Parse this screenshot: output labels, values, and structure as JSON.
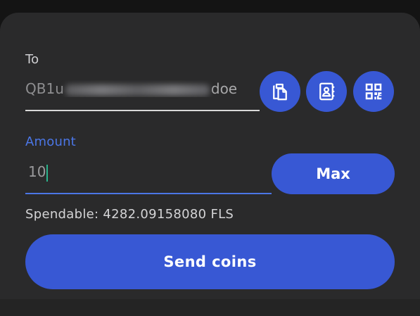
{
  "form": {
    "to_label": "To",
    "address_start": "QB1u",
    "address_end": "doe",
    "amount_label": "Amount",
    "amount_value": "10",
    "max_label": "Max",
    "spendable_text": "Spendable: 4282.09158080 FLS",
    "send_label": "Send coins"
  },
  "icons": {
    "paste": "clipboard-paste-icon",
    "contacts": "address-book-icon",
    "scan": "qr-code-icon"
  },
  "colors": {
    "background": "#141414",
    "sheet": "#2a2a2b",
    "accent": "#3858d4",
    "focus_label": "#4b76e6",
    "caret": "#2bb38c"
  }
}
